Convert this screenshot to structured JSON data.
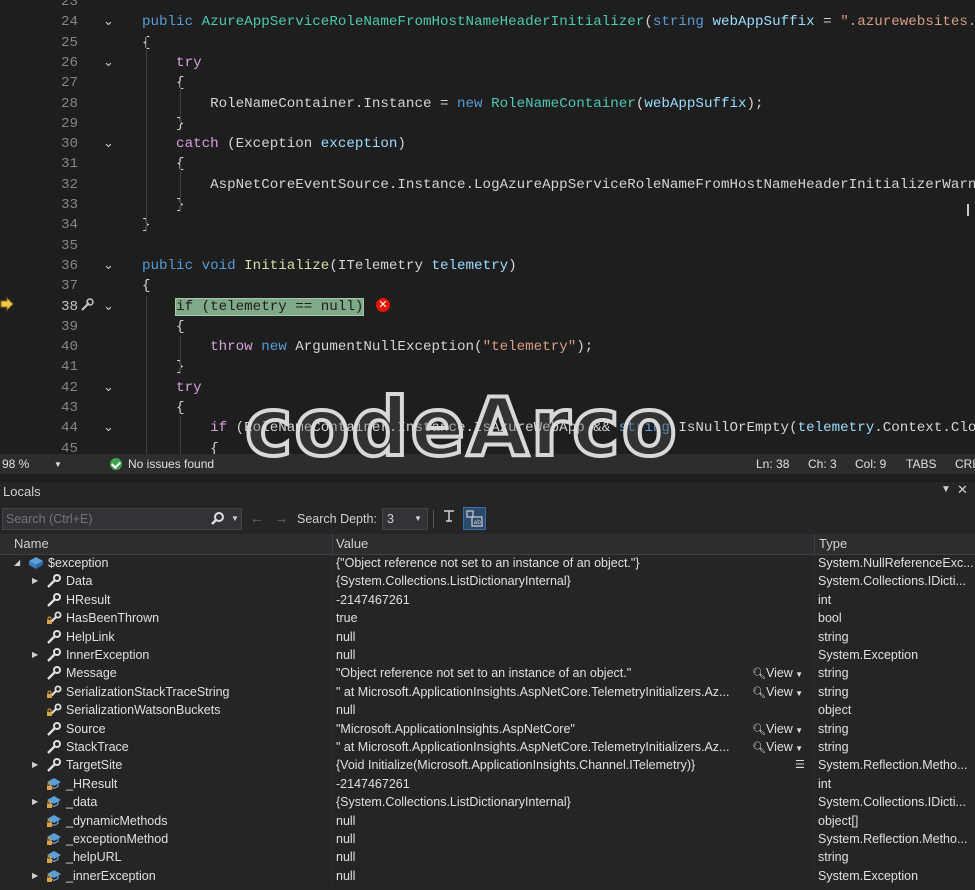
{
  "editor": {
    "lines": [
      {
        "n": "23",
        "tokens": []
      },
      {
        "n": "24",
        "tokens": [
          [
            "kw",
            "public "
          ],
          [
            "ty",
            "AzureAppServiceRoleNameFromHostNameHeaderInitializer"
          ],
          [
            "tx",
            "("
          ],
          [
            "kw",
            "string "
          ],
          [
            "pr",
            "webAppSuffix"
          ],
          [
            "tx",
            " = "
          ],
          [
            "st",
            "\".azurewebsites.ne"
          ]
        ]
      },
      {
        "n": "25",
        "tokens": [
          [
            "tx",
            "{"
          ]
        ]
      },
      {
        "n": "26",
        "tokens": [
          [
            "ctl",
            "    try"
          ]
        ]
      },
      {
        "n": "27",
        "tokens": [
          [
            "tx",
            "    {"
          ]
        ]
      },
      {
        "n": "28",
        "tokens": [
          [
            "tx",
            "        RoleNameContainer.Instance = "
          ],
          [
            "kw",
            "new "
          ],
          [
            "ty",
            "RoleNameContainer"
          ],
          [
            "tx",
            "("
          ],
          [
            "pr",
            "webAppSuffix"
          ],
          [
            "tx",
            ");"
          ]
        ]
      },
      {
        "n": "29",
        "tokens": [
          [
            "tx",
            "    }"
          ]
        ]
      },
      {
        "n": "30",
        "tokens": [
          [
            "ctl",
            "    catch"
          ],
          [
            "tx",
            " (Exception "
          ],
          [
            "pr",
            "exception"
          ],
          [
            "tx",
            ")"
          ]
        ]
      },
      {
        "n": "31",
        "tokens": [
          [
            "tx",
            "    {"
          ]
        ]
      },
      {
        "n": "32",
        "tokens": [
          [
            "tx",
            "        AspNetCoreEventSource.Instance.LogAzureAppServiceRoleNameFromHostNameHeaderInitializerWarnin"
          ]
        ]
      },
      {
        "n": "33",
        "tokens": [
          [
            "tx",
            "    }"
          ]
        ]
      },
      {
        "n": "34",
        "tokens": [
          [
            "tx",
            "}"
          ]
        ]
      },
      {
        "n": "35",
        "tokens": []
      },
      {
        "n": "36",
        "tokens": [
          [
            "kw",
            "public void "
          ],
          [
            "mt",
            "Initialize"
          ],
          [
            "tx",
            "(ITelemetry "
          ],
          [
            "pr",
            "telemetry"
          ],
          [
            "tx",
            ")"
          ]
        ]
      },
      {
        "n": "37",
        "tokens": [
          [
            "tx",
            "{"
          ]
        ]
      },
      {
        "n": "38",
        "tokens": [
          [
            "tx",
            "    "
          ],
          [
            "hl",
            "if (telemetry == null)"
          ]
        ]
      },
      {
        "n": "39",
        "tokens": [
          [
            "tx",
            "    {"
          ]
        ]
      },
      {
        "n": "40",
        "tokens": [
          [
            "ctl",
            "        throw "
          ],
          [
            "kw",
            "new "
          ],
          [
            "tx",
            "ArgumentNullException("
          ],
          [
            "st",
            "\"telemetry\""
          ],
          [
            "tx",
            ");"
          ]
        ]
      },
      {
        "n": "41",
        "tokens": [
          [
            "tx",
            "    }"
          ]
        ]
      },
      {
        "n": "42",
        "tokens": [
          [
            "ctl",
            "    try"
          ]
        ]
      },
      {
        "n": "43",
        "tokens": [
          [
            "tx",
            "    {"
          ]
        ]
      },
      {
        "n": "44",
        "tokens": [
          [
            "ctl",
            "        if"
          ],
          [
            "tx",
            " (RoleNameContainer.Instance.IsAzureWebApp && "
          ],
          [
            "kw",
            "string"
          ],
          [
            "tx",
            ".IsNullOrEmpty("
          ],
          [
            "pr",
            "telemetry"
          ],
          [
            "tx",
            ".Context.Clouc"
          ]
        ]
      },
      {
        "n": "45",
        "tokens": [
          [
            "tx",
            "        {"
          ]
        ]
      }
    ],
    "current_line": "38"
  },
  "editor_status": {
    "zoom": "98 %",
    "issues": "No issues found",
    "ln": "Ln: 38",
    "ch": "Ch: 3",
    "col": "Col: 9",
    "tabs": "TABS",
    "eol": "CRL"
  },
  "locals": {
    "title": "Locals",
    "search_placeholder": "Search (Ctrl+E)",
    "search_depth_label": "Search Depth:",
    "search_depth_value": "3",
    "columns": {
      "name": "Name",
      "value": "Value",
      "type": "Type"
    },
    "view_label": "View",
    "rows": [
      {
        "level": 0,
        "expander": "expanded",
        "icon": "exception",
        "name": "$exception",
        "value": "{\"Object reference not set to an instance of an object.\"}",
        "type": "System.NullReferenceExc..."
      },
      {
        "level": 1,
        "expander": "collapsed",
        "icon": "wrench",
        "name": "Data",
        "value": "{System.Collections.ListDictionaryInternal}",
        "type": "System.Collections.IDicti..."
      },
      {
        "level": 1,
        "expander": "none",
        "icon": "wrench",
        "name": "HResult",
        "value": "-2147467261",
        "type": "int"
      },
      {
        "level": 1,
        "expander": "none",
        "icon": "wrench-lock",
        "name": "HasBeenThrown",
        "value": "true",
        "type": "bool"
      },
      {
        "level": 1,
        "expander": "none",
        "icon": "wrench",
        "name": "HelpLink",
        "value": "null",
        "type": "string"
      },
      {
        "level": 1,
        "expander": "collapsed",
        "icon": "wrench",
        "name": "InnerException",
        "value": "null",
        "type": "System.Exception"
      },
      {
        "level": 1,
        "expander": "none",
        "icon": "wrench",
        "name": "Message",
        "value": "\"Object reference not set to an instance of an object.\"",
        "type": "string",
        "view": true
      },
      {
        "level": 1,
        "expander": "none",
        "icon": "wrench-lock",
        "name": "SerializationStackTraceString",
        "value": "\"   at Microsoft.ApplicationInsights.AspNetCore.TelemetryInitializers.Az...",
        "type": "string",
        "view": true
      },
      {
        "level": 1,
        "expander": "none",
        "icon": "wrench-lock",
        "name": "SerializationWatsonBuckets",
        "value": "null",
        "type": "object"
      },
      {
        "level": 1,
        "expander": "none",
        "icon": "wrench",
        "name": "Source",
        "value": "\"Microsoft.ApplicationInsights.AspNetCore\"",
        "type": "string",
        "view": true
      },
      {
        "level": 1,
        "expander": "none",
        "icon": "wrench",
        "name": "StackTrace",
        "value": "\"   at Microsoft.ApplicationInsights.AspNetCore.TelemetryInitializers.Az...",
        "type": "string",
        "view": true
      },
      {
        "level": 1,
        "expander": "collapsed",
        "icon": "wrench",
        "name": "TargetSite",
        "value": "{Void Initialize(Microsoft.ApplicationInsights.Channel.ITelemetry)}",
        "type": "System.Reflection.Metho...",
        "visualizer": true
      },
      {
        "level": 1,
        "expander": "none",
        "icon": "field-lock",
        "name": "_HResult",
        "value": "-2147467261",
        "type": "int"
      },
      {
        "level": 1,
        "expander": "collapsed",
        "icon": "field-lock",
        "name": "_data",
        "value": "{System.Collections.ListDictionaryInternal}",
        "type": "System.Collections.IDicti..."
      },
      {
        "level": 1,
        "expander": "none",
        "icon": "field-lock",
        "name": "_dynamicMethods",
        "value": "null",
        "type": "object[]"
      },
      {
        "level": 1,
        "expander": "none",
        "icon": "field-lock",
        "name": "_exceptionMethod",
        "value": "null",
        "type": "System.Reflection.Metho..."
      },
      {
        "level": 1,
        "expander": "none",
        "icon": "field-lock",
        "name": "_helpURL",
        "value": "null",
        "type": "string"
      },
      {
        "level": 1,
        "expander": "collapsed",
        "icon": "field-lock",
        "name": "_innerException",
        "value": "null",
        "type": "System.Exception"
      }
    ]
  },
  "watermark": "codeArco",
  "colors": {
    "keyword": "#569cd6",
    "control": "#d8a0df",
    "type": "#4ec9b0",
    "method": "#dcdcaa",
    "param": "#9cdcfe",
    "string": "#d69d85",
    "highlight": "#7fa988",
    "error": "#e51400"
  }
}
